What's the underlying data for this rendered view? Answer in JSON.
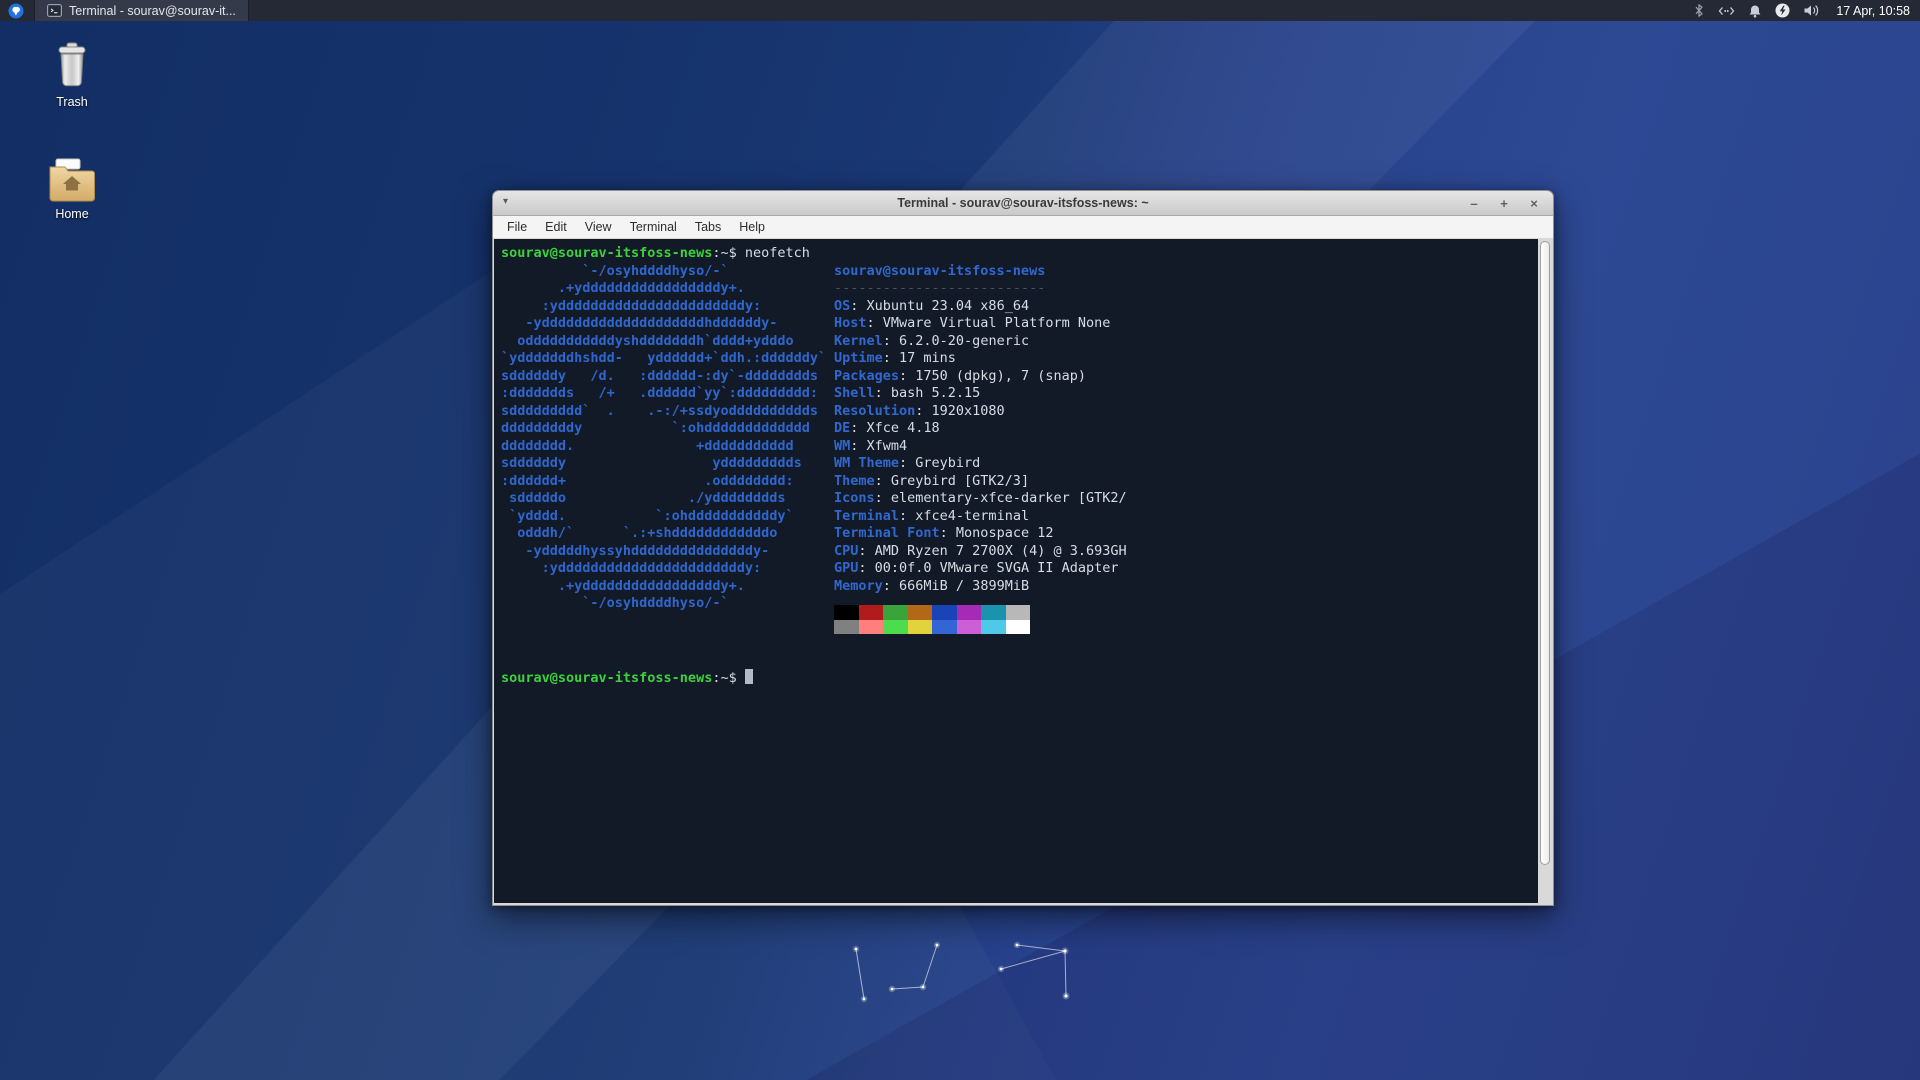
{
  "panel": {
    "window_button_label": "Terminal - sourav@sourav-it...",
    "clock": "17 Apr, 10:58",
    "tray_icons": [
      "bluetooth",
      "network",
      "notifications",
      "power-manager",
      "volume"
    ]
  },
  "desktop": {
    "icons": [
      {
        "label": "Trash"
      },
      {
        "label": "Home"
      }
    ]
  },
  "window": {
    "title": "Terminal - sourav@sourav-itsfoss-news: ~",
    "dropdown_arrow": "▾",
    "menu": [
      "File",
      "Edit",
      "View",
      "Terminal",
      "Tabs",
      "Help"
    ],
    "controls": {
      "minimize": "–",
      "maximize": "+",
      "close": "×"
    }
  },
  "terminal": {
    "prompt_user": "sourav@sourav-itsfoss-news",
    "prompt_suffix": ":~$ ",
    "command": "neofetch",
    "prompt_user2": "sourav@sourav-itsfoss-news",
    "prompt_suffix2": ":~$",
    "ascii_art": [
      "          `-/osyhddddhyso/-`",
      "       .+ydddddddddddddddddy+.",
      "     :ydddddddddddddddddddddddy:",
      "   -yddddddddddddddddddddhddddddy-",
      "  odddddddddddyshdddddddh`dddd+ydddo",
      "`ydddddddhshdd-   ydddddd+`ddh.:ddddddy`",
      "sddddddy   /d.   :dddddd-:dy`-dddddddds",
      ":ddddddds   /+   .dddddd`yy`:ddddddddd:",
      "sddddddddd`  .    .-:/+ssdyodddddddddds",
      "dddddddddy           `:ohddddddddddddd",
      "dddddddd.               +ddddddddddd",
      "sddddddy                  yddddddddds",
      ":dddddd+                 .odddddddd:",
      " sdddddo               ./ydddddddds",
      " `ydddd.           `:ohdddddddddddy`",
      "  odddh/`      `.:+shddddddddddddo",
      "   -ydddddhyssyhdddddddddddddddy-",
      "     :ydddddddddddddddddddddddy:",
      "       .+ydddddddddddddddddy+.",
      "          `-/osyhddddhyso/-`"
    ],
    "info_title": "sourav@sourav-itsfoss-news",
    "info_separator": "--------------------------",
    "info": [
      {
        "label": "OS",
        "value": "Xubuntu 23.04 x86_64"
      },
      {
        "label": "Host",
        "value": "VMware Virtual Platform None"
      },
      {
        "label": "Kernel",
        "value": "6.2.0-20-generic"
      },
      {
        "label": "Uptime",
        "value": "17 mins"
      },
      {
        "label": "Packages",
        "value": "1750 (dpkg), 7 (snap)"
      },
      {
        "label": "Shell",
        "value": "bash 5.2.15"
      },
      {
        "label": "Resolution",
        "value": "1920x1080"
      },
      {
        "label": "DE",
        "value": "Xfce 4.18"
      },
      {
        "label": "WM",
        "value": "Xfwm4"
      },
      {
        "label": "WM Theme",
        "value": "Greybird"
      },
      {
        "label": "Theme",
        "value": "Greybird [GTK2/3]"
      },
      {
        "label": "Icons",
        "value": "elementary-xfce-darker [GTK2/"
      },
      {
        "label": "Terminal",
        "value": "xfce4-terminal"
      },
      {
        "label": "Terminal Font",
        "value": "Monospace 12"
      },
      {
        "label": "CPU",
        "value": "AMD Ryzen 7 2700X (4) @ 3.693GH"
      },
      {
        "label": "GPU",
        "value": "00:0f.0 VMware SVGA II Adapter"
      },
      {
        "label": "Memory",
        "value": "666MiB / 3899MiB"
      }
    ],
    "palette_row1": [
      "#000000",
      "#b21b1b",
      "#3aa33a",
      "#b26818",
      "#1a43b8",
      "#a52ab5",
      "#1b93ad",
      "#b8b8b8"
    ],
    "palette_row2": [
      "#808080",
      "#ff7f7f",
      "#4cdd4c",
      "#e2d33c",
      "#3465d4",
      "#cc5fd6",
      "#4ec9e8",
      "#ffffff"
    ]
  },
  "colors": {
    "terminal_bg": "#131a27",
    "prompt_green": "#3bd23b",
    "neofetch_blue": "#3168cf",
    "panel_bg": "#252936",
    "accent_wallpaper": "#27428b"
  }
}
